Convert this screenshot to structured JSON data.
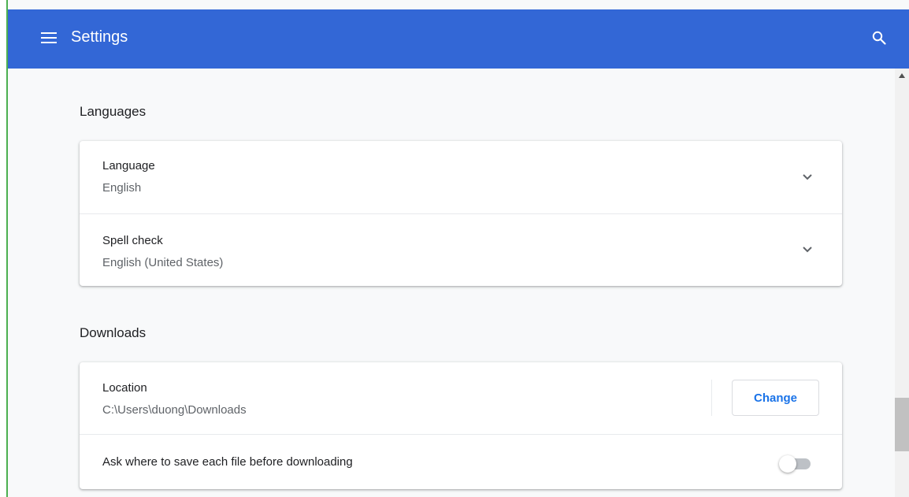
{
  "toolbar": {
    "title": "Settings",
    "menu_icon": "hamburger-menu-icon",
    "search_icon": "search-icon",
    "background_color": "#3367d6"
  },
  "languages_section": {
    "title": "Languages",
    "rows": [
      {
        "label": "Language",
        "value": "English",
        "icon": "chevron-down-icon"
      },
      {
        "label": "Spell check",
        "value": "English (United States)",
        "icon": "chevron-down-icon"
      }
    ]
  },
  "downloads_section": {
    "title": "Downloads",
    "location": {
      "label": "Location",
      "value": "C:\\Users\\duong\\Downloads",
      "button_label": "Change"
    },
    "ask_where": {
      "label": "Ask where to save each file before downloading",
      "enabled": false
    }
  },
  "colors": {
    "accent": "#1a73e8",
    "toolbar": "#3367d6",
    "background": "#f8f9fa"
  }
}
